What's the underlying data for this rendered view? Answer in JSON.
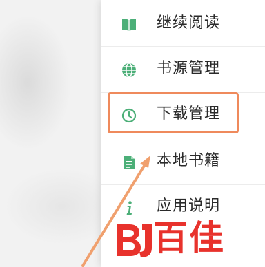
{
  "menu": {
    "items": [
      {
        "label": "继续阅读",
        "icon": "book-icon"
      },
      {
        "label": "书源管理",
        "icon": "globe-icon"
      },
      {
        "label": "下载管理",
        "icon": "clock-icon"
      },
      {
        "label": "本地书籍",
        "icon": "document-icon"
      },
      {
        "label": "应用说明",
        "icon": "info-icon"
      }
    ],
    "highlighted_item": "下载管理"
  },
  "watermark": {
    "text": "百佳",
    "logo": "BJ"
  },
  "colors": {
    "icon": "#4caf78",
    "highlight": "#ef8a5c",
    "watermark": "#e8322c"
  }
}
